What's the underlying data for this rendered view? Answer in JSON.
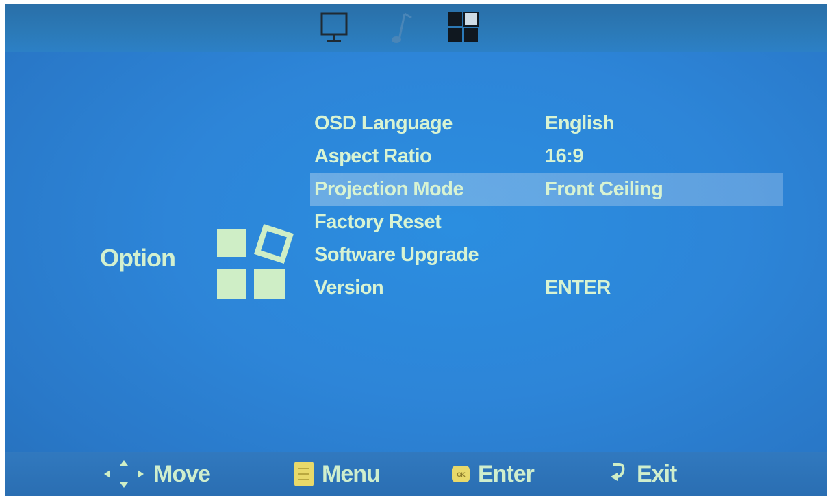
{
  "top_tabs": [
    {
      "icon": "monitor-icon",
      "active": false
    },
    {
      "icon": "music-note-icon",
      "active": false
    },
    {
      "icon": "option-grid-icon",
      "active": true
    }
  ],
  "section": {
    "title": "Option",
    "icon": "option-grid-icon"
  },
  "menu": {
    "items": [
      {
        "label": "OSD Language",
        "value": "English"
      },
      {
        "label": "Aspect Ratio",
        "value": "16:9"
      },
      {
        "label": "Projection Mode",
        "value": "Front Ceiling",
        "selected": true
      },
      {
        "label": "Factory Reset",
        "value": ""
      },
      {
        "label": "Software Upgrade",
        "value": ""
      },
      {
        "label": "Version",
        "value": "ENTER"
      }
    ]
  },
  "footer": {
    "move_label": "Move",
    "menu_label": "Menu",
    "enter_label": "Enter",
    "exit_label": "Exit"
  },
  "colors": {
    "background": "#2d85d8",
    "text": "#d8f3d2",
    "icon": "#cfeec6",
    "selection": "#8fb9e3"
  }
}
